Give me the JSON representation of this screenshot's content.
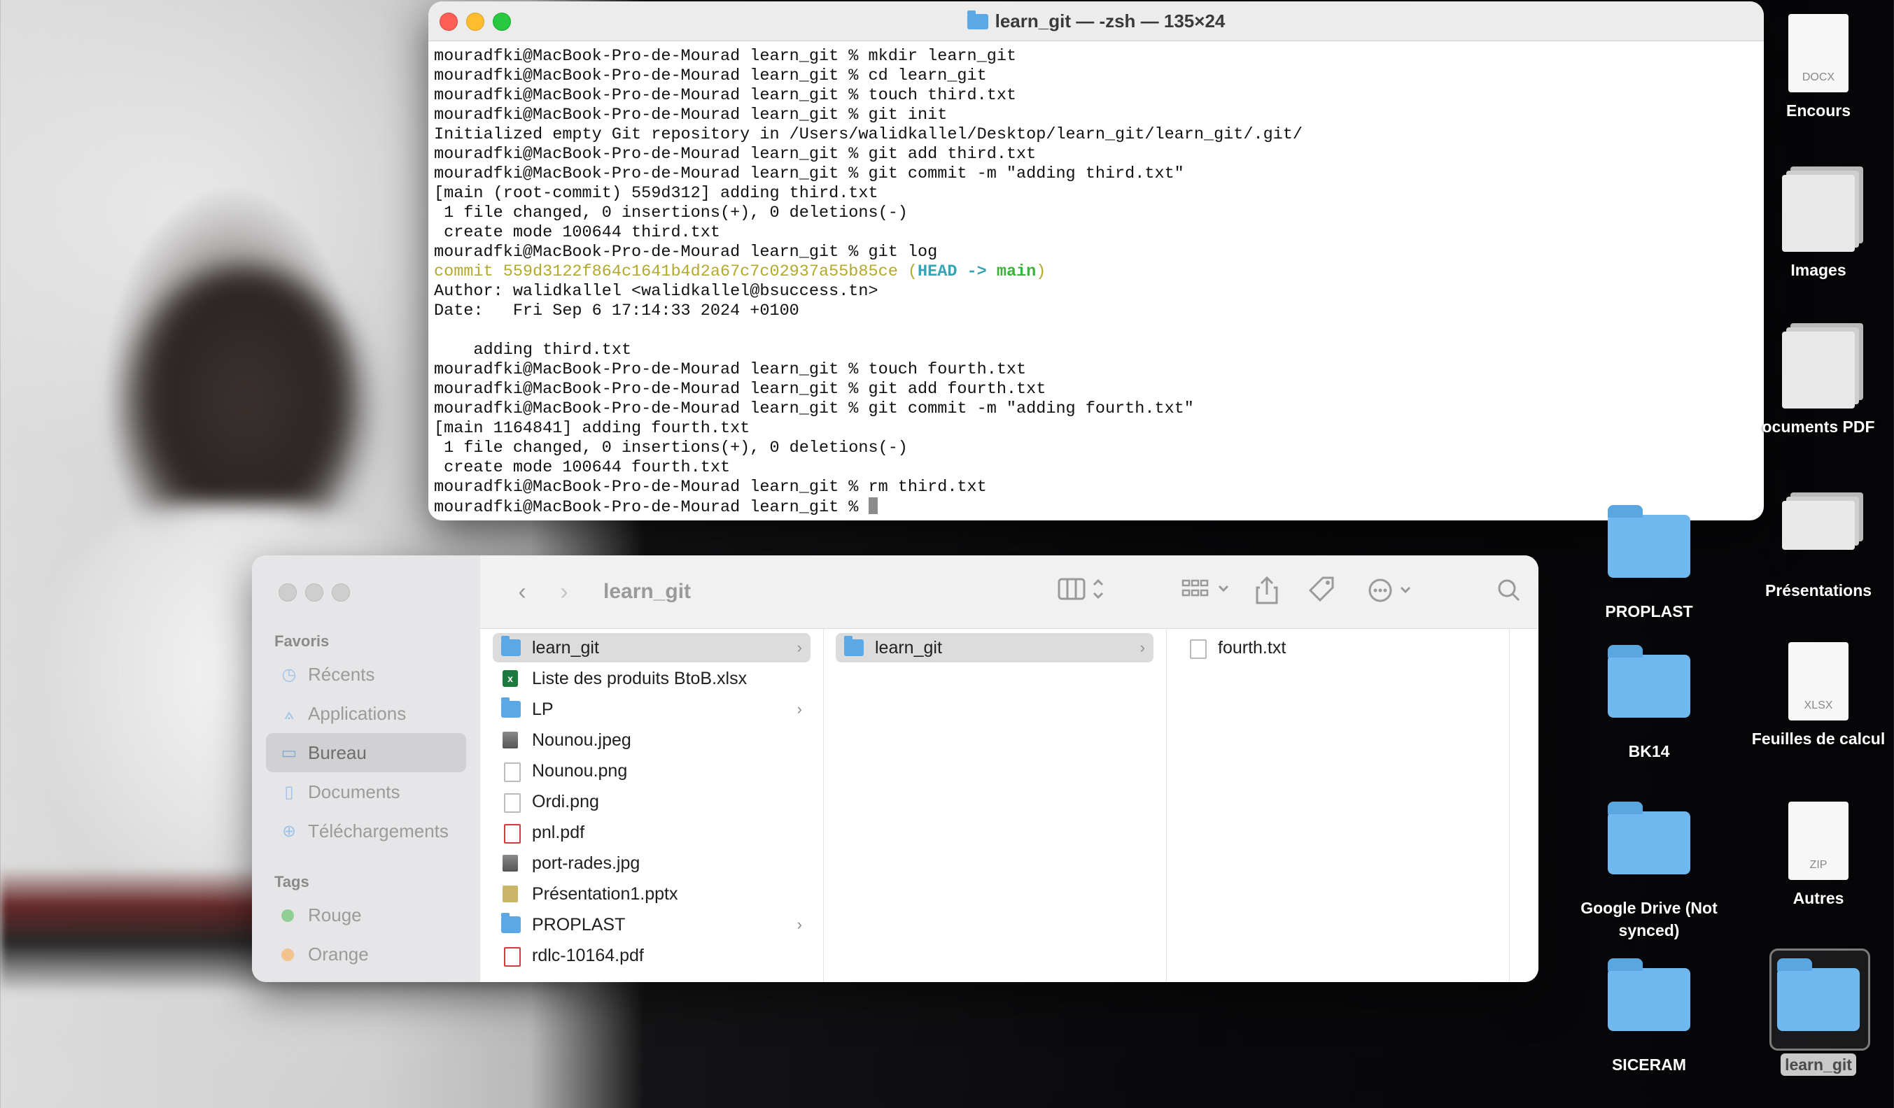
{
  "terminal": {
    "title": "learn_git — -zsh — 135×24",
    "lines": [
      "mouradfki@MacBook-Pro-de-Mourad learn_git % mkdir learn_git",
      "mouradfki@MacBook-Pro-de-Mourad learn_git % cd learn_git",
      "mouradfki@MacBook-Pro-de-Mourad learn_git % touch third.txt",
      "mouradfki@MacBook-Pro-de-Mourad learn_git % git init",
      "Initialized empty Git repository in /Users/walidkallel/Desktop/learn_git/learn_git/.git/",
      "mouradfki@MacBook-Pro-de-Mourad learn_git % git add third.txt",
      "mouradfki@MacBook-Pro-de-Mourad learn_git % git commit -m \"adding third.txt\"",
      "[main (root-commit) 559d312] adding third.txt",
      " 1 file changed, 0 insertions(+), 0 deletions(-)",
      " create mode 100644 third.txt",
      "mouradfki@MacBook-Pro-de-Mourad learn_git % git log"
    ],
    "commit_prefix": "commit 559d3122f864c1641b4d2a67c7c02937a55b85ce (",
    "commit_head": "HEAD -> ",
    "commit_branch": "main",
    "commit_suffix": ")",
    "lines2": [
      "Author: walidkallel <walidkallel@bsuccess.tn>",
      "Date:   Fri Sep 6 17:14:33 2024 +0100",
      "",
      "    adding third.txt",
      "mouradfki@MacBook-Pro-de-Mourad learn_git % touch fourth.txt",
      "mouradfki@MacBook-Pro-de-Mourad learn_git % git add fourth.txt",
      "mouradfki@MacBook-Pro-de-Mourad learn_git % git commit -m \"adding fourth.txt\"",
      "[main 1164841] adding fourth.txt",
      " 1 file changed, 0 insertions(+), 0 deletions(-)",
      " create mode 100644 fourth.txt",
      "mouradfki@MacBook-Pro-de-Mourad learn_git % rm third.txt"
    ],
    "prompt": "mouradfki@MacBook-Pro-de-Mourad learn_git % "
  },
  "finder": {
    "title": "learn_git",
    "sidebar": {
      "favorites_label": "Favoris",
      "items": [
        "Récents",
        "Applications",
        "Bureau",
        "Documents",
        "Téléchargements"
      ],
      "tags_label": "Tags",
      "tags": [
        {
          "label": "Rouge",
          "color": "#5ec26a"
        },
        {
          "label": "Orange",
          "color": "#f0a85a"
        }
      ]
    },
    "col1": [
      {
        "name": "learn_git",
        "type": "folder",
        "chevron": "›"
      },
      {
        "name": "Liste des produits BtoB.xlsx",
        "type": "xls"
      },
      {
        "name": "LP",
        "type": "folder",
        "chevron": "›"
      },
      {
        "name": "Nounou.jpeg",
        "type": "img"
      },
      {
        "name": "Nounou.png",
        "type": "doc"
      },
      {
        "name": "Ordi.png",
        "type": "doc"
      },
      {
        "name": "pnl.pdf",
        "type": "pdf"
      },
      {
        "name": "port-rades.jpg",
        "type": "img"
      },
      {
        "name": "Présentation1.pptx",
        "type": "ppt"
      },
      {
        "name": "PROPLAST",
        "type": "folder",
        "chevron": "›"
      },
      {
        "name": "rdlc-10164.pdf",
        "type": "pdf"
      }
    ],
    "col2": [
      {
        "name": "learn_git",
        "chevron": "›"
      }
    ],
    "col3": [
      {
        "name": "fourth.txt"
      }
    ]
  },
  "desktop": {
    "icons": [
      {
        "label": "Encours",
        "kind": "docx",
        "badge": "DOCX"
      },
      {
        "label": "Images",
        "kind": "stack"
      },
      {
        "label": "ocuments PDF",
        "kind": "stack"
      },
      {
        "label": "PROPLAST",
        "kind": "folder"
      },
      {
        "label": "Présentations",
        "kind": "stack"
      },
      {
        "label": "BK14",
        "kind": "folder"
      },
      {
        "label": "Feuilles de calcul",
        "kind": "docx",
        "badge": "XLSX"
      },
      {
        "label": "Google Drive (Not synced)",
        "kind": "folder"
      },
      {
        "label": "Autres",
        "kind": "docx",
        "badge": "ZIP"
      },
      {
        "label": "SICERAM",
        "kind": "folder"
      },
      {
        "label": "learn_git",
        "kind": "folder"
      }
    ]
  }
}
